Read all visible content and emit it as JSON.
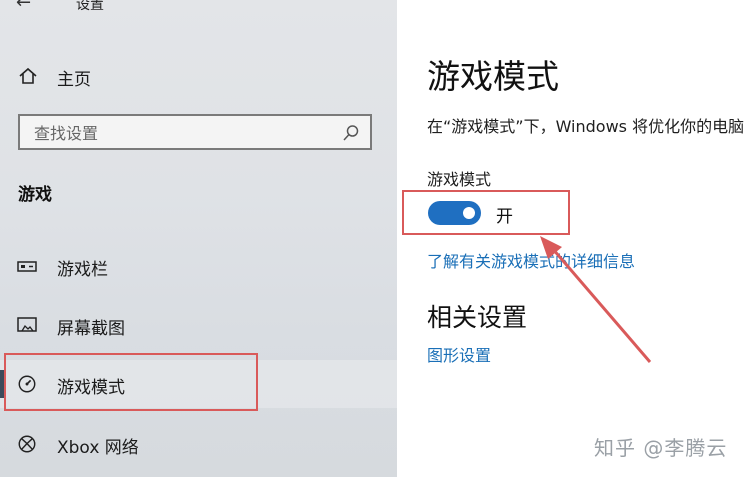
{
  "window": {
    "title": "设置",
    "back_icon": "back-arrow-icon"
  },
  "sidebar": {
    "home_label": "主页",
    "search_placeholder": "查找设置",
    "section_title": "游戏",
    "items": [
      {
        "label": "游戏栏",
        "icon": "game-bar-icon"
      },
      {
        "label": "屏幕截图",
        "icon": "screen-capture-icon"
      },
      {
        "label": "游戏模式",
        "icon": "game-mode-icon",
        "selected": true
      },
      {
        "label": "Xbox 网络",
        "icon": "xbox-icon"
      }
    ]
  },
  "main": {
    "title": "游戏模式",
    "description": "在“游戏模式”下，Windows 将优化你的电脑",
    "setting_label": "游戏模式",
    "toggle_state": "开",
    "toggle_on": true,
    "learn_more_link": "了解有关游戏模式的详细信息",
    "related_title": "相关设置",
    "graphics_link": "图形设置"
  },
  "watermark": "知乎 @李腾云",
  "colors": {
    "accent": "#1f6fc1",
    "link": "#1a6fb7",
    "annotation": "#d95a5a"
  }
}
